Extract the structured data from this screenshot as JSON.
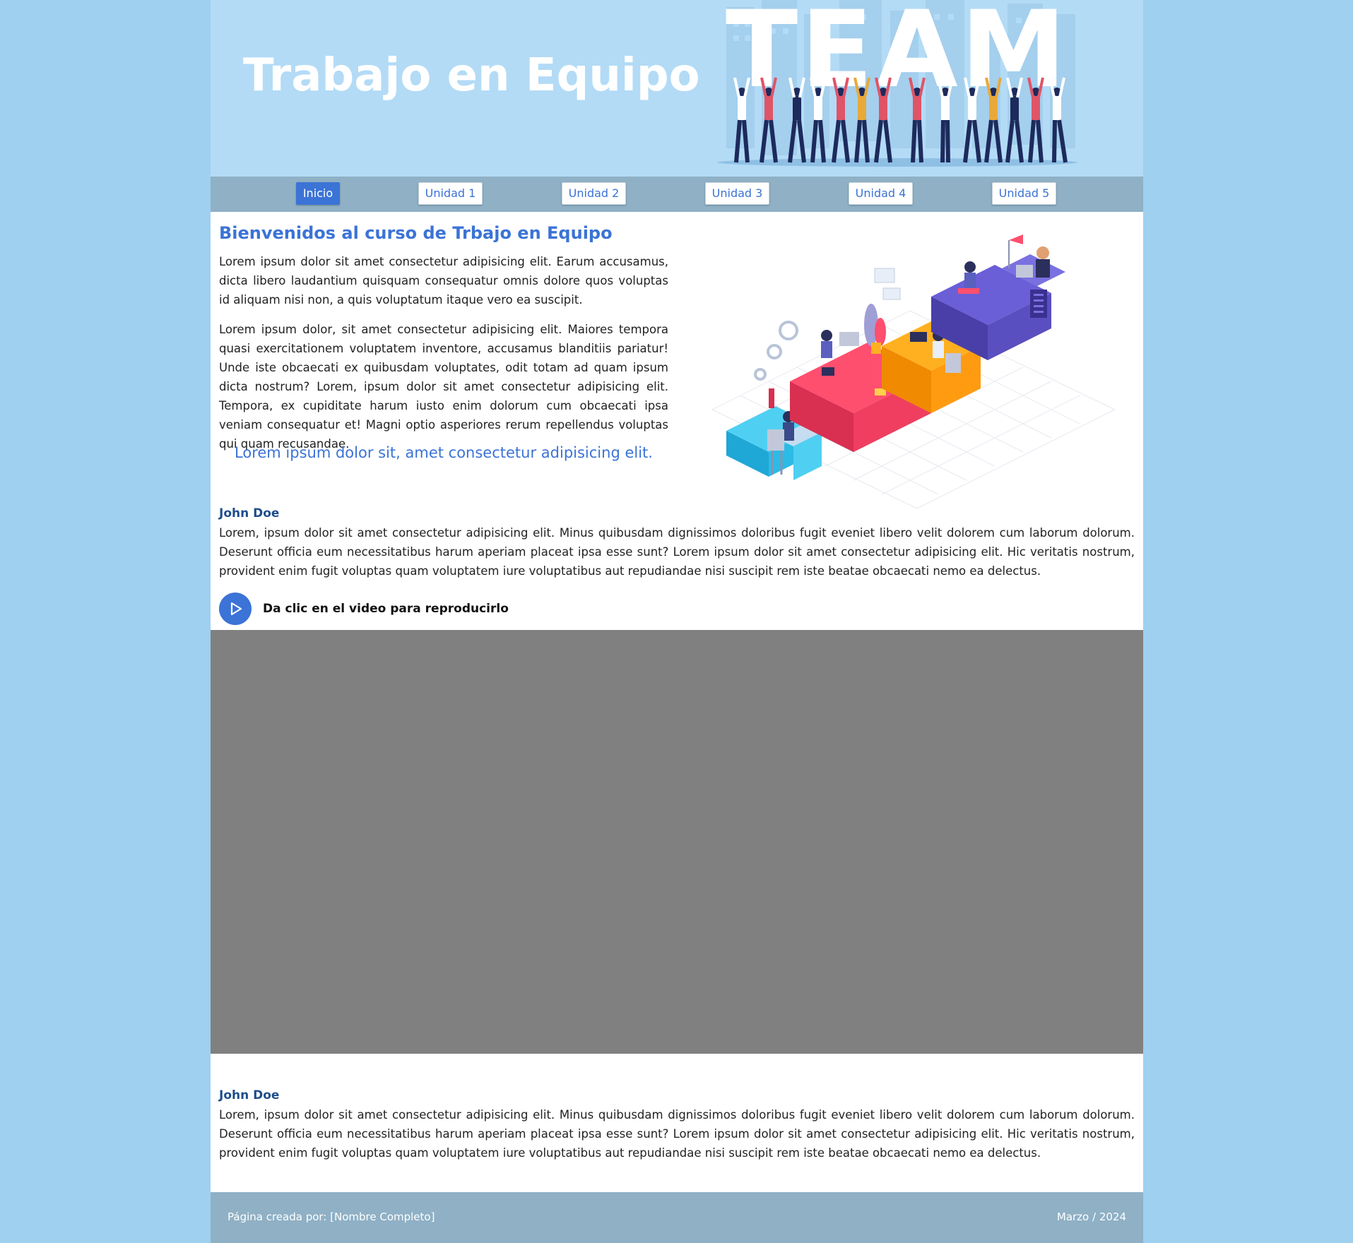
{
  "header": {
    "title": "Trabajo en Equipo",
    "banner_word": "TEAM"
  },
  "nav": {
    "items": [
      {
        "label": "Inicio",
        "active": true
      },
      {
        "label": "Unidad 1",
        "active": false
      },
      {
        "label": "Unidad 2",
        "active": false
      },
      {
        "label": "Unidad 3",
        "active": false
      },
      {
        "label": "Unidad 4",
        "active": false
      },
      {
        "label": "Unidad 5",
        "active": false
      }
    ]
  },
  "intro": {
    "title": "Bienvenidos al curso de Trbajo en Equipo",
    "paragraphs": [
      "Lorem ipsum dolor sit amet consectetur adipisicing elit. Earum accusamus, dicta libero laudantium quisquam consequatur omnis dolore quos voluptas id aliquam nisi non, a quis voluptatum itaque vero ea suscipit.",
      "Lorem ipsum dolor, sit amet consectetur adipisicing elit. Maiores tempora quasi exercitationem voluptatem inventore, accusamus blanditiis pariatur! Unde iste obcaecati ex quibusdam voluptates, odit totam ad quam ipsum dicta nostrum? Lorem, ipsum dolor sit amet consectetur adipisicing elit. Tempora, ex cupiditate harum iusto enim dolorum cum obcaecati ipsa veniam consequatur et! Magni optio asperiores rerum repellendus voluptas qui quam recusandae."
    ],
    "highlight": "Lorem ipsum dolor sit, amet consectetur adipisicing elit."
  },
  "testimonials": [
    {
      "author": "John Doe",
      "text": "Lorem, ipsum dolor sit amet consectetur adipisicing elit. Minus quibusdam dignissimos doloribus fugit eveniet libero velit dolorem cum laborum dolorum. Deserunt officia eum necessitatibus harum aperiam placeat ipsa esse sunt? Lorem ipsum dolor sit amet consectetur adipisicing elit. Hic veritatis nostrum, provident enim fugit voluptas quam voluptatem iure voluptatibus aut repudiandae nisi suscipit rem iste beatae obcaecati nemo ea delectus."
    },
    {
      "author": "John Doe",
      "text": "Lorem, ipsum dolor sit amet consectetur adipisicing elit. Minus quibusdam dignissimos doloribus fugit eveniet libero velit dolorem cum laborum dolorum. Deserunt officia eum necessitatibus harum aperiam placeat ipsa esse sunt? Lorem ipsum dolor sit amet consectetur adipisicing elit. Hic veritatis nostrum, provident enim fugit voluptas quam voluptatem iure voluptatibus aut repudiandae nisi suscipit rem iste beatae obcaecati nemo ea delectus."
    }
  ],
  "video": {
    "prompt": "Da clic en el video para reproducirlo",
    "icon": "play-icon"
  },
  "footer": {
    "credit": "Página creada por: [Nombre Completo]",
    "date": "Marzo / 2024"
  },
  "colors": {
    "background": "#9fd0f0",
    "header": "#b3dbf6",
    "nav": "#8fb0c5",
    "accent": "#3b73d6",
    "author": "#1f4e8c",
    "video_placeholder": "#808080"
  }
}
